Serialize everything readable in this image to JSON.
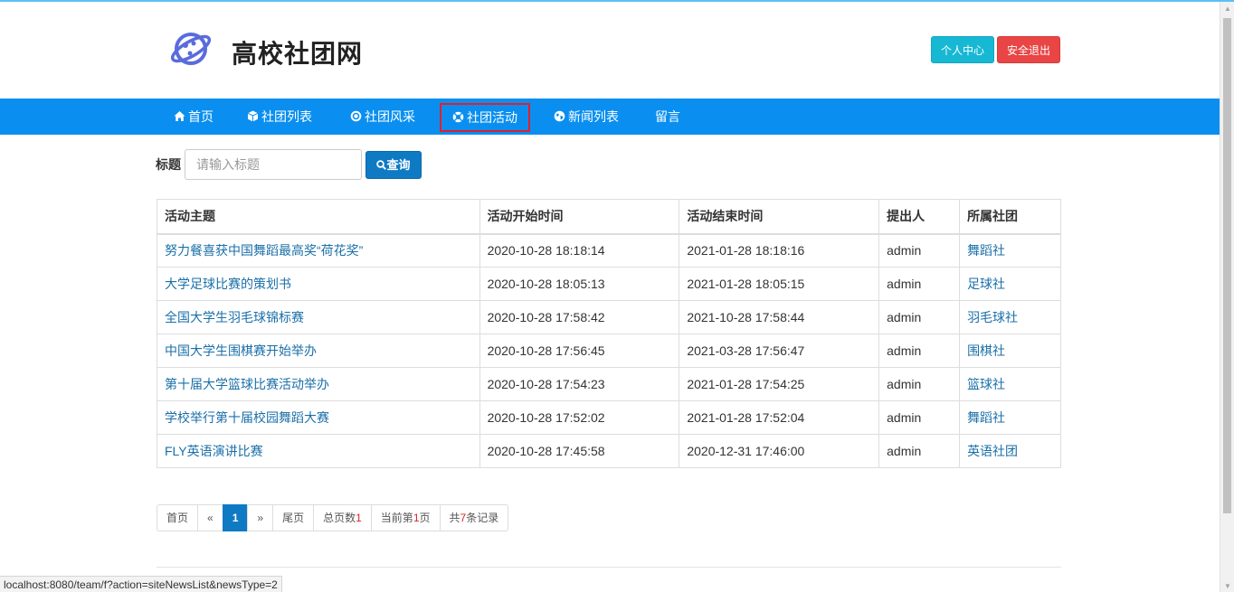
{
  "header": {
    "site_title": "高校社团网",
    "logo_icon": "planet-logo-icon",
    "user_center_label": "个人中心",
    "logout_label": "安全退出"
  },
  "nav": {
    "items": [
      {
        "label": "首页",
        "icon": "home-icon"
      },
      {
        "label": "社团列表",
        "icon": "cube-icon"
      },
      {
        "label": "社团风采",
        "icon": "target-icon"
      },
      {
        "label": "社团活动",
        "icon": "lifebuoy-icon",
        "active": true
      },
      {
        "label": "新闻列表",
        "icon": "globe-icon"
      },
      {
        "label": "留言",
        "icon": ""
      }
    ]
  },
  "search": {
    "label": "标题",
    "placeholder": "请输入标题",
    "value": "",
    "button_label": "查询"
  },
  "table": {
    "headers": [
      "活动主题",
      "活动开始时间",
      "活动结束时间",
      "提出人",
      "所属社团"
    ],
    "rows": [
      [
        "努力餐喜获中国舞蹈最高奖“荷花奖”",
        "2020-10-28 18:18:14",
        "2021-01-28 18:18:16",
        "admin",
        "舞蹈社"
      ],
      [
        "大学足球比赛的策划书",
        "2020-10-28 18:05:13",
        "2021-01-28 18:05:15",
        "admin",
        "足球社"
      ],
      [
        "全国大学生羽毛球锦标赛",
        "2020-10-28 17:58:42",
        "2021-10-28 17:58:44",
        "admin",
        "羽毛球社"
      ],
      [
        "中国大学生围棋赛开始举办",
        "2020-10-28 17:56:45",
        "2021-03-28 17:56:47",
        "admin",
        "围棋社"
      ],
      [
        "第十届大学篮球比赛活动举办",
        "2020-10-28 17:54:23",
        "2021-01-28 17:54:25",
        "admin",
        "篮球社"
      ],
      [
        "学校举行第十届校园舞蹈大赛",
        "2020-10-28 17:52:02",
        "2021-01-28 17:52:04",
        "admin",
        "舞蹈社"
      ],
      [
        "FLY英语演讲比赛",
        "2020-10-28 17:45:58",
        "2020-12-31 17:46:00",
        "admin",
        "英语社团"
      ]
    ]
  },
  "pagination": {
    "first": "首页",
    "prev": "«",
    "current": "1",
    "next": "»",
    "last": "尾页",
    "total_pages_prefix": "总页数",
    "total_pages": "1",
    "current_page_prefix": "当前第",
    "current_page": "1",
    "current_page_suffix": "页",
    "records_prefix": "共",
    "records": "7",
    "records_suffix": "条记录"
  },
  "statusbar": {
    "url": "localhost:8080/team/f?action=siteNewsList&newsType=2"
  },
  "colors": {
    "nav_bg": "#0a8ff0",
    "primary": "#0e7ac4",
    "info": "#17b8d3",
    "danger": "#e94545",
    "highlight_border": "#e0202a",
    "link": "#1a6fa8"
  }
}
